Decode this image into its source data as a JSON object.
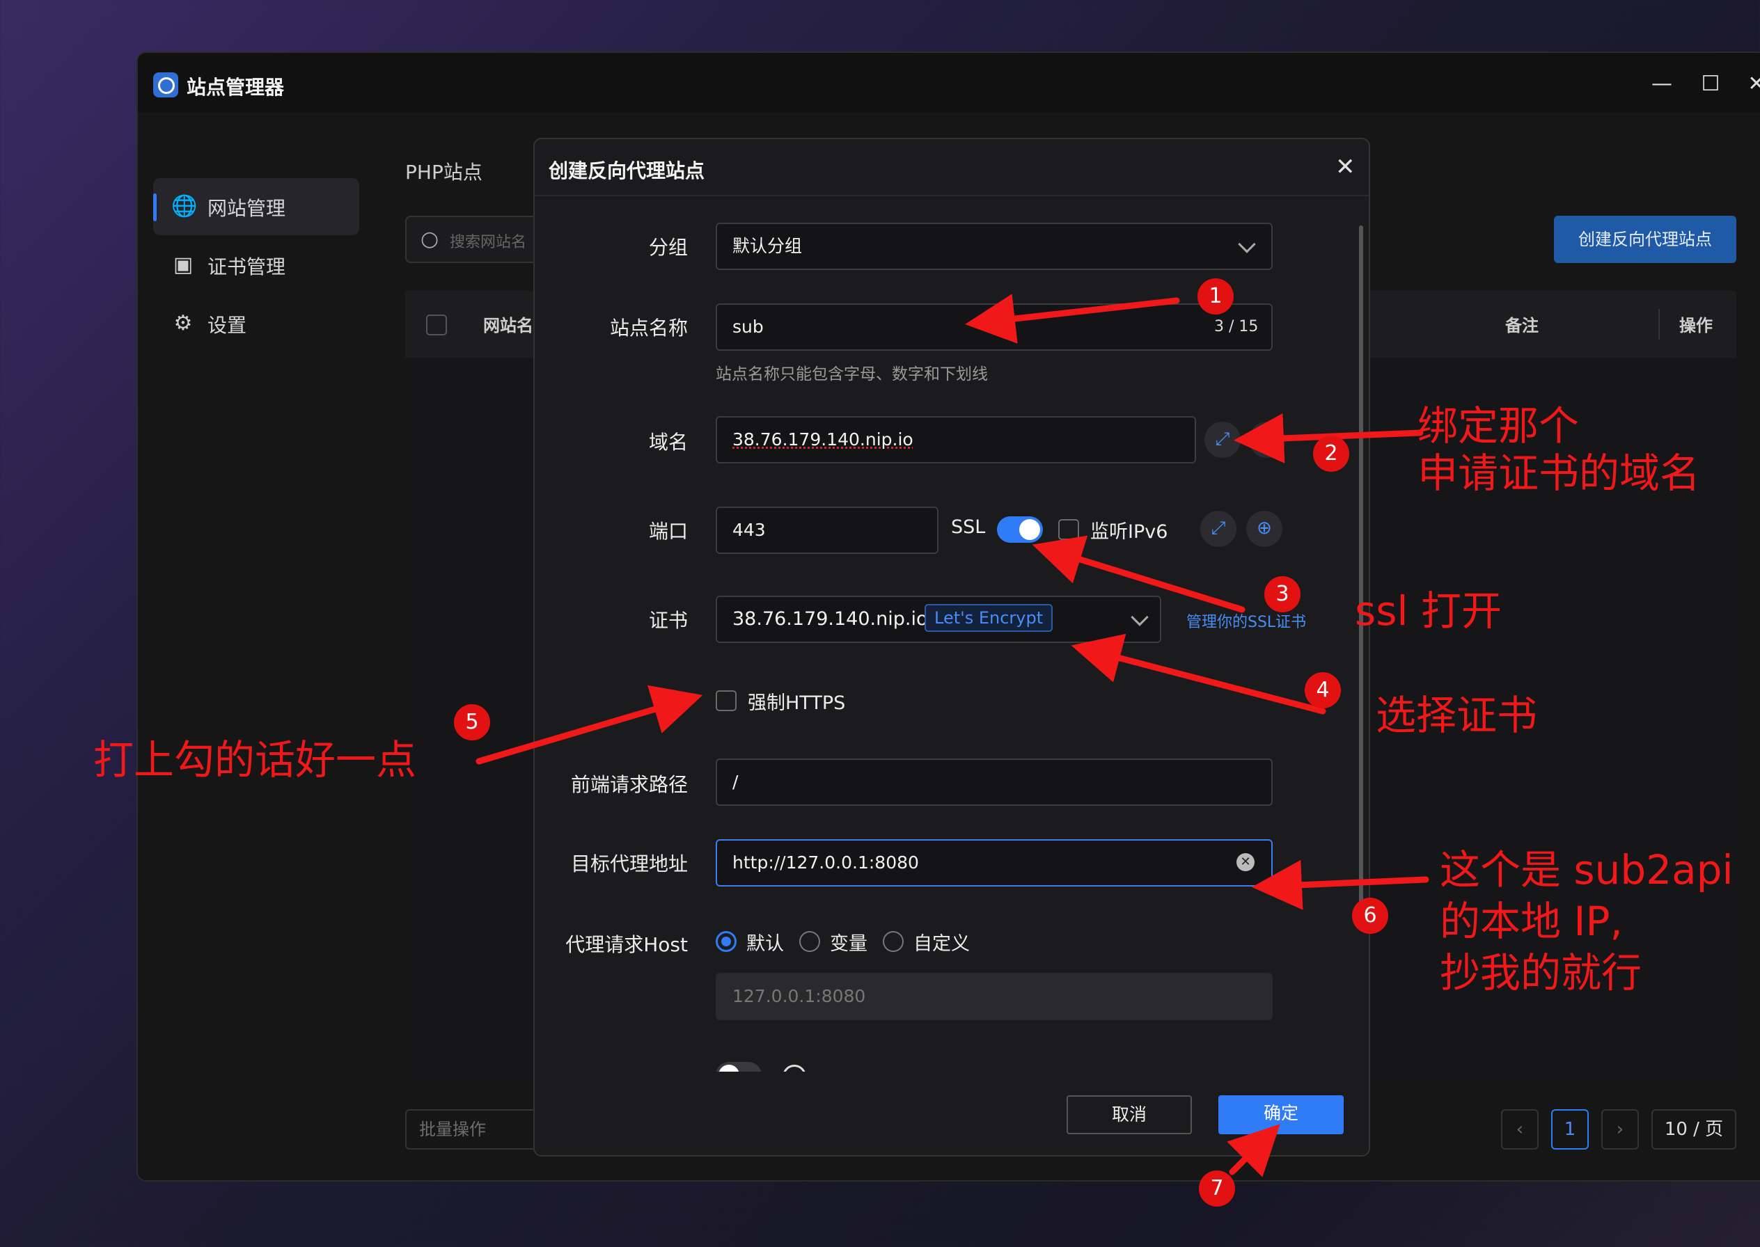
{
  "window": {
    "title": "站点管理器",
    "controls": {
      "minimize": "—",
      "maximize": "☐",
      "close": "✕"
    }
  },
  "sidebar": {
    "items": [
      {
        "label": "网站管理",
        "icon": "globe-icon",
        "active": true
      },
      {
        "label": "证书管理",
        "icon": "certificate-icon",
        "active": false
      },
      {
        "label": "设置",
        "icon": "gear-icon",
        "active": false
      }
    ]
  },
  "content": {
    "title": "PHP站点",
    "search_placeholder": "搜索网站名",
    "create_button": "创建反向代理站点",
    "table_headers": {
      "name": "网站名",
      "remark": "备注",
      "action": "操作"
    },
    "batch_button": "批量操作",
    "pager": {
      "prev": "‹",
      "page": "1",
      "next": "›",
      "page_size": "10 / 页"
    }
  },
  "modal": {
    "title": "创建反向代理站点",
    "close": "✕",
    "group": {
      "label": "分组",
      "value": "默认分组"
    },
    "site_name": {
      "label": "站点名称",
      "value": "sub",
      "counter": "3 / 15",
      "hint": "站点名称只能包含字母、数字和下划线"
    },
    "domain": {
      "label": "域名",
      "value": "38.76.179.140.nip.io"
    },
    "port": {
      "label": "端口",
      "value": "443",
      "ssl_label": "SSL",
      "ssl_on": true,
      "ipv6_label": "监听IPv6"
    },
    "cert": {
      "label": "证书",
      "value": "38.76.179.140.nip.io",
      "issuer": "Let's Encrypt",
      "manage_link": "管理你的SSL证书"
    },
    "force_https": {
      "label": "强制HTTPS",
      "checked": false
    },
    "front_path": {
      "label": "前端请求路径",
      "value": "/"
    },
    "target": {
      "label": "目标代理地址",
      "value": "http://127.0.0.1:8080"
    },
    "proxy_host": {
      "label": "代理请求Host",
      "options": [
        "默认",
        "变量",
        "自定义"
      ],
      "selected": "默认",
      "value": "127.0.0.1:8080"
    },
    "cancel_button": "取消",
    "ok_button": "确定"
  },
  "annotations": {
    "a2_line1": "绑定那个",
    "a2_line2": "申请证书的域名",
    "a3": "ssl 打开",
    "a4": "选择证书",
    "a5": "打上勾的话好一点",
    "a6_line1": "这个是 sub2api",
    "a6_line2": "的本地 IP,",
    "a6_line3": "抄我的就行",
    "numbers": [
      "1",
      "2",
      "3",
      "4",
      "5",
      "6",
      "7"
    ]
  },
  "colors": {
    "accent": "#2f7cf6",
    "annotation": "#f01818"
  }
}
